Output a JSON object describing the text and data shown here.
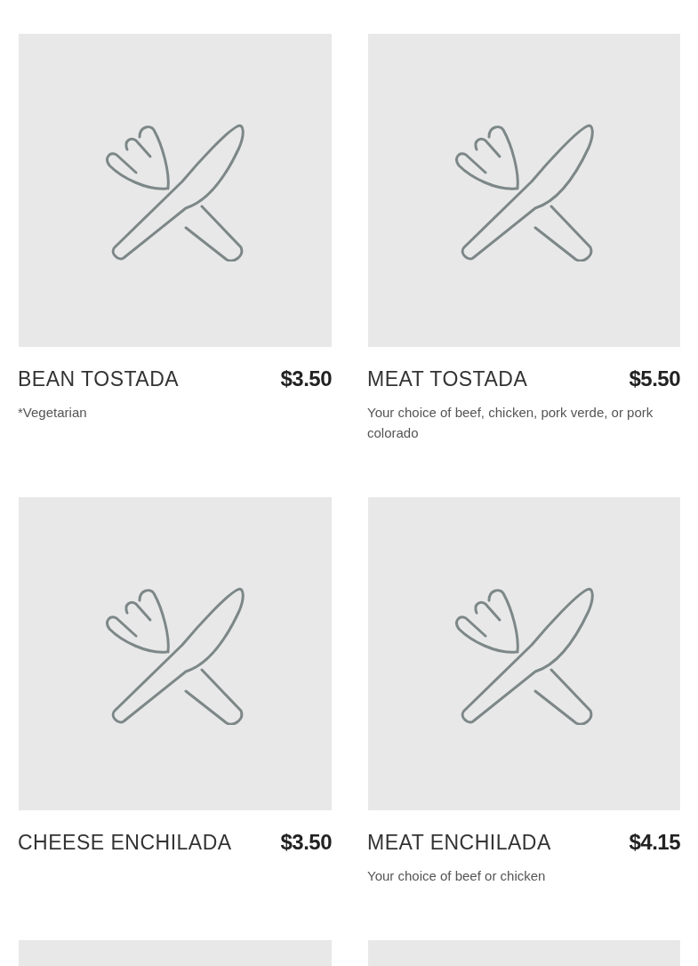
{
  "items": [
    {
      "kind": "dish",
      "name": "BEAN TOSTADA",
      "price": "$3.50",
      "description": "*Vegetarian"
    },
    {
      "kind": "dish",
      "name": "MEAT TOSTADA",
      "price": "$5.50",
      "description": "Your choice of beef, chicken, pork verde, or pork colorado"
    },
    {
      "kind": "dish",
      "name": "CHEESE ENCHILADA",
      "price": "$3.50"
    },
    {
      "kind": "dish",
      "name": "MEAT ENCHILADA",
      "price": "$4.15",
      "description": "Your choice of beef or chicken"
    },
    {
      "kind": "image-only"
    },
    {
      "kind": "image-only"
    }
  ]
}
